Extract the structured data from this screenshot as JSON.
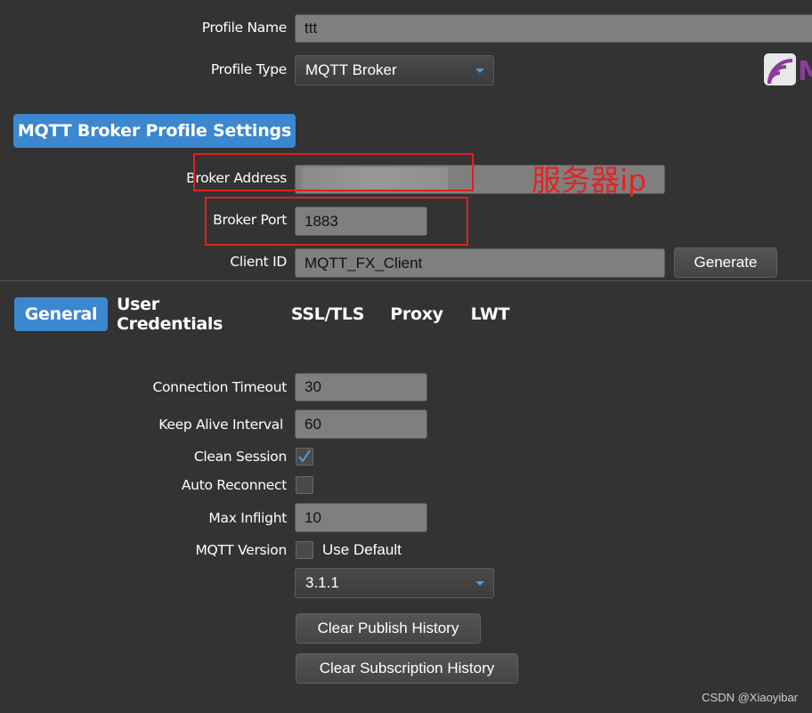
{
  "profile": {
    "name_label": "Profile Name",
    "name_value": "ttt",
    "type_label": "Profile Type",
    "type_value": "MQTT Broker",
    "logo_letter": "M"
  },
  "broker_section": {
    "title": "MQTT Broker Profile Settings",
    "address_label": "Broker Address",
    "address_value": "",
    "port_label": "Broker Port",
    "port_value": "1883",
    "client_id_label": "Client ID",
    "client_id_value": "MQTT_FX_Client",
    "generate_button": "Generate"
  },
  "annotation": {
    "text": "服务器ip",
    "color": "#e02020"
  },
  "tabs": [
    {
      "label": "General",
      "active": true
    },
    {
      "label": "User Credentials",
      "active": false
    },
    {
      "label": "SSL/TLS",
      "active": false
    },
    {
      "label": "Proxy",
      "active": false
    },
    {
      "label": "LWT",
      "active": false
    }
  ],
  "general": {
    "connection_timeout_label": "Connection Timeout",
    "connection_timeout_value": "30",
    "keep_alive_label": "Keep Alive Interval",
    "keep_alive_value": "60",
    "clean_session_label": "Clean Session",
    "clean_session_checked": true,
    "auto_reconnect_label": "Auto Reconnect",
    "auto_reconnect_checked": false,
    "max_inflight_label": "Max Inflight",
    "max_inflight_value": "10",
    "mqtt_version_label": "MQTT Version",
    "use_default_label": "Use Default",
    "use_default_checked": false,
    "version_value": "3.1.1",
    "clear_publish_button": "Clear Publish History",
    "clear_subscription_button": "Clear Subscription History"
  },
  "watermark": "CSDN @Xiaoyibar",
  "colors": {
    "accent": "#3b87d0",
    "background": "#333333",
    "field": "#7f7f7f",
    "annotation": "#e02020"
  }
}
